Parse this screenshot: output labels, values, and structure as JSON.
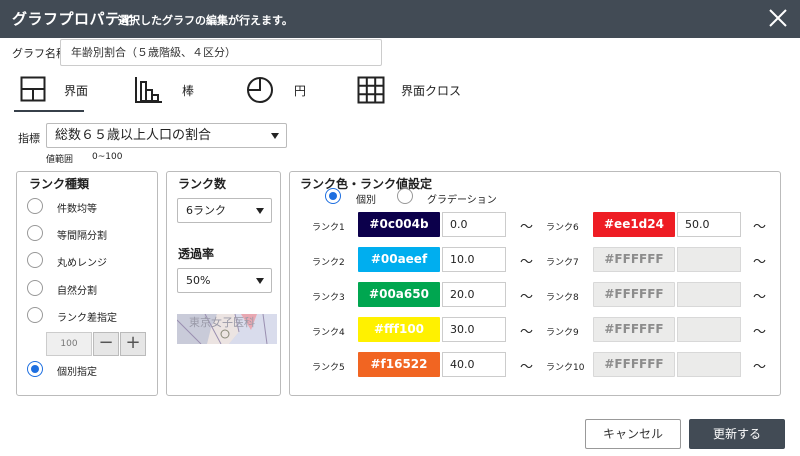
{
  "dialog": {
    "title": "グラフプロパティ",
    "subtitle": "選択したグラフの編集が行えます。",
    "close_icon": "close-icon"
  },
  "graph_name": {
    "label": "グラフ名称",
    "value": "年齢別割合（５歳階級、４区分）"
  },
  "tabs": [
    {
      "label": "界面",
      "icon": "area-layout-icon",
      "active": true
    },
    {
      "label": "棒",
      "icon": "bar-chart-icon",
      "active": false
    },
    {
      "label": "円",
      "icon": "pie-chart-icon",
      "active": false
    },
    {
      "label": "界面クロス",
      "icon": "grid-cross-icon",
      "active": false
    }
  ],
  "metric": {
    "label": "指標",
    "value": "総数６５歳以上人口の割合",
    "range_label": "値範囲",
    "range_value": "0~100"
  },
  "rank_type": {
    "title": "ランク種類",
    "options": [
      "件数均等",
      "等間隔分割",
      "丸めレンジ",
      "自然分割",
      "ランク差指定",
      "個別指定"
    ],
    "selected": "個別指定",
    "step_value": "100",
    "minus_icon": "minus-icon",
    "plus_icon": "plus-icon"
  },
  "rank_count": {
    "title": "ランク数",
    "value": "6ランク",
    "transparency_title": "透過率",
    "transparency_value": "50%",
    "preview_text": "東京女子医科"
  },
  "rank_colors": {
    "title": "ランク色・ランク値設定",
    "mode_options": [
      "個別",
      "グラデーション"
    ],
    "mode_selected": "個別",
    "tilde": "～",
    "ranks": [
      {
        "label": "ランク1",
        "color": "#0c004b",
        "color_text": "#0c004b",
        "value": "0.0",
        "enabled": true
      },
      {
        "label": "ランク2",
        "color": "#00aeef",
        "color_text": "#00aeef",
        "value": "10.0",
        "enabled": true
      },
      {
        "label": "ランク3",
        "color": "#00a650",
        "color_text": "#00a650",
        "value": "20.0",
        "enabled": true
      },
      {
        "label": "ランク4",
        "color": "#fff100",
        "color_text": "#fff100",
        "value": "30.0",
        "enabled": true
      },
      {
        "label": "ランク5",
        "color": "#f16522",
        "color_text": "#f16522",
        "value": "40.0",
        "enabled": true
      },
      {
        "label": "ランク6",
        "color": "#ee1d24",
        "color_text": "#ee1d24",
        "value": "50.0",
        "enabled": true
      },
      {
        "label": "ランク7",
        "color": "#FFFFFF",
        "color_text": "#FFFFFF",
        "value": "",
        "enabled": false
      },
      {
        "label": "ランク8",
        "color": "#FFFFFF",
        "color_text": "#FFFFFF",
        "value": "",
        "enabled": false
      },
      {
        "label": "ランク9",
        "color": "#FFFFFF",
        "color_text": "#FFFFFF",
        "value": "",
        "enabled": false
      },
      {
        "label": "ランク10",
        "color": "#FFFFFF",
        "color_text": "#FFFFFF",
        "value": "",
        "enabled": false
      }
    ]
  },
  "footer": {
    "cancel_label": "キャンセル",
    "update_label": "更新する"
  },
  "colors": {
    "titlebar": "#424b55",
    "accent": "#1e6fe0"
  }
}
